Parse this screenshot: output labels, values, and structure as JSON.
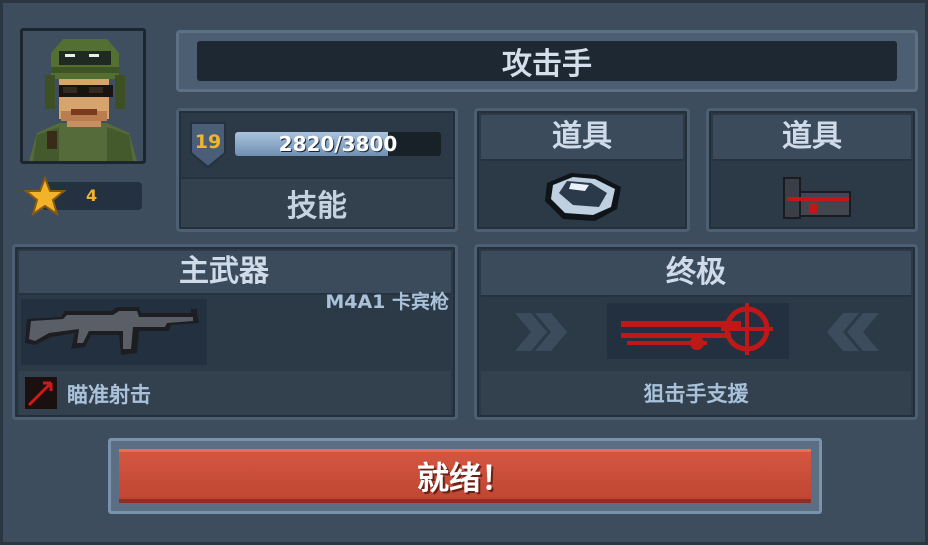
{
  "character": {
    "name": "攻击手",
    "rank": "4",
    "level": "19",
    "xp_text": "2820/3800",
    "xp_fraction": 0.742
  },
  "skill": {
    "label": "技能"
  },
  "items": [
    {
      "label": "道具",
      "icon": "armor-vest-icon"
    },
    {
      "label": "道具",
      "icon": "red-dot-sight-icon"
    }
  ],
  "primary_weapon": {
    "header": "主武器",
    "name": "M4A1 卡宾枪",
    "icon": "rifle-icon",
    "ability": "瞄准射击",
    "ability_icon": "aim-shot-icon"
  },
  "ultimate": {
    "header": "终极",
    "name": "狙击手支援",
    "icon": "sniper-scope-icon"
  },
  "ready": {
    "label": "就绪！"
  },
  "colors": {
    "accent_gold": "#f0b52a",
    "ready_red": "#c8503a",
    "panel_dark": "#2c3947",
    "ultimate_red": "#c01818"
  }
}
